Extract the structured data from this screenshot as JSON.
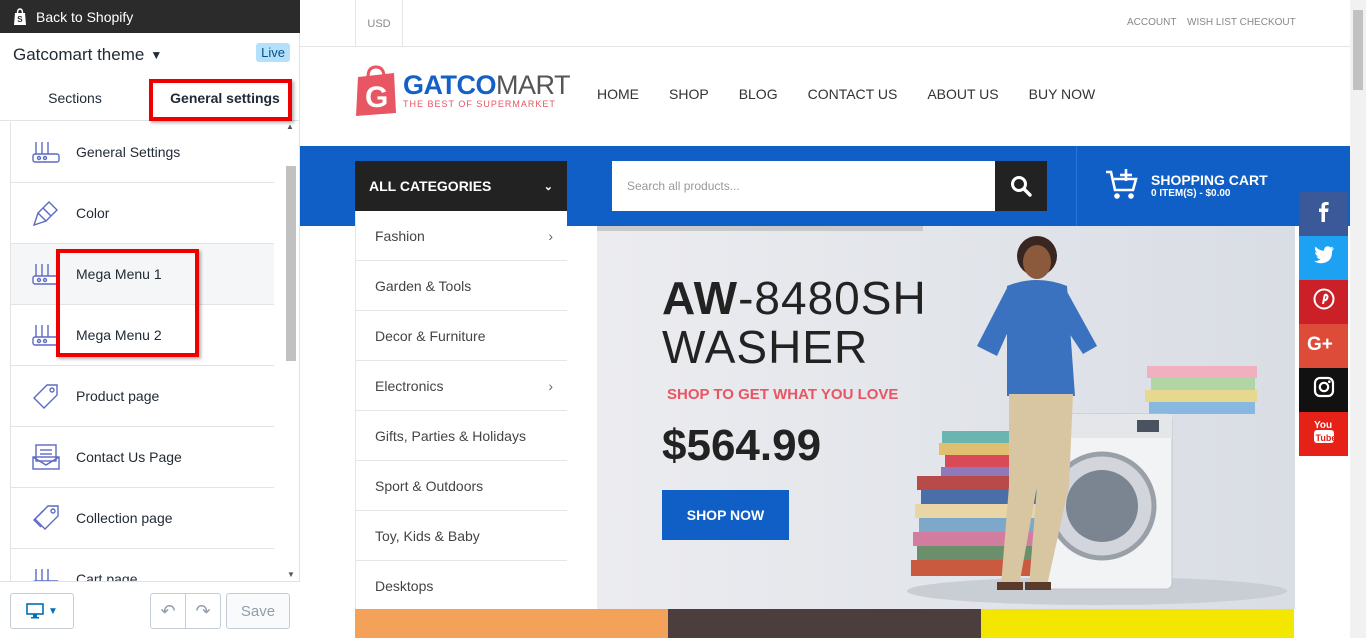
{
  "editor": {
    "back_label": "Back to Shopify",
    "theme_name": "Gatcomart theme",
    "live_badge": "Live",
    "tabs": [
      {
        "label": "Sections"
      },
      {
        "label": "General settings"
      }
    ],
    "settings": [
      {
        "label": "General Settings",
        "icon": "settings-icon"
      },
      {
        "label": "Color",
        "icon": "brush-icon"
      },
      {
        "label": "Mega Menu 1",
        "icon": "settings-icon"
      },
      {
        "label": "Mega Menu 2",
        "icon": "settings-icon"
      },
      {
        "label": "Product page",
        "icon": "tag-icon"
      },
      {
        "label": "Contact Us Page",
        "icon": "mail-icon"
      },
      {
        "label": "Collection page",
        "icon": "tags-icon"
      },
      {
        "label": "Cart page",
        "icon": "settings-icon"
      }
    ],
    "save_label": "Save"
  },
  "store": {
    "currency": "USD",
    "account": "ACCOUNT",
    "wishlist": "WISH LIST CHECKOUT",
    "logo_main_a": "GATCO",
    "logo_main_b": "MART",
    "logo_tagline": "THE BEST OF SUPERMARKET",
    "nav": [
      "HOME",
      "SHOP",
      "BLOG",
      "CONTACT US",
      "ABOUT US",
      "BUY NOW"
    ],
    "all_categories": "ALL CATEGORIES",
    "search_placeholder": "Search all products...",
    "cart_title": "SHOPPING CART",
    "cart_sub": "0 ITEM(S) - $0.00",
    "categories": [
      {
        "label": "Fashion",
        "arrow": true
      },
      {
        "label": "Garden & Tools",
        "arrow": false
      },
      {
        "label": "Decor & Furniture",
        "arrow": false
      },
      {
        "label": "Electronics",
        "arrow": true
      },
      {
        "label": "Gifts, Parties & Holidays",
        "arrow": false
      },
      {
        "label": "Sport & Outdoors",
        "arrow": false
      },
      {
        "label": "Toy, Kids & Baby",
        "arrow": false
      },
      {
        "label": "Desktops",
        "arrow": false
      }
    ],
    "banner": {
      "title_bold": "AW",
      "title_rest": "-8480SH",
      "title_line2": "WASHER",
      "subtitle": "SHOP TO GET WHAT YOU LOVE",
      "price": "$564.99",
      "button": "SHOP NOW"
    },
    "social": [
      {
        "name": "facebook-icon",
        "glyph": "f",
        "color": "#3b5998"
      },
      {
        "name": "twitter-icon",
        "glyph": "t",
        "color": "#1da1f2"
      },
      {
        "name": "pinterest-icon",
        "glyph": "p",
        "color": "#cb2027"
      },
      {
        "name": "google-plus-icon",
        "glyph": "G+",
        "color": "#dd4b39"
      },
      {
        "name": "instagram-icon",
        "glyph": "ig",
        "color": "#111111"
      },
      {
        "name": "youtube-icon",
        "glyph": "You",
        "color": "#e62117"
      }
    ]
  },
  "colors": {
    "brand_blue": "#0f5fc6",
    "accent_red": "#e85563",
    "highlight_box": "#ee0000"
  }
}
